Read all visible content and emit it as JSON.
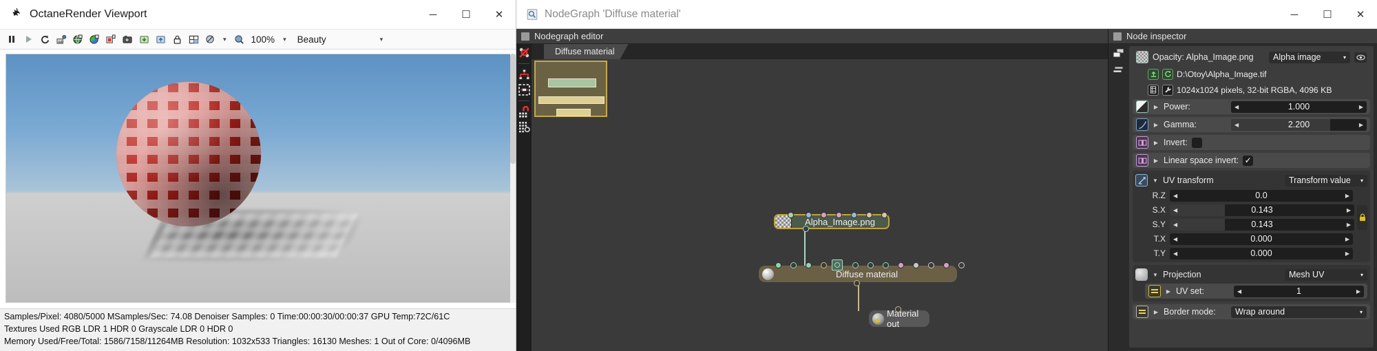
{
  "viewport": {
    "title": "OctaneRender Viewport",
    "logo_icon": "octane-logo-icon",
    "window_controls": {
      "minimize": "─",
      "maximize": "☐",
      "close": "✕"
    },
    "toolbar": {
      "items": [
        {
          "name": "pause-button",
          "glyph": "pause"
        },
        {
          "name": "play-button",
          "glyph": "play"
        },
        {
          "name": "restart-render-button",
          "glyph": "restart"
        },
        {
          "name": "render-settings-button",
          "glyph": "settings"
        },
        {
          "name": "save-image-button",
          "glyph": "save-image"
        },
        {
          "name": "color-picker-button",
          "glyph": "color"
        },
        {
          "name": "save-render-pass-button",
          "glyph": "save-pass"
        },
        {
          "name": "camera-button",
          "glyph": "camera"
        },
        {
          "name": "import-button",
          "glyph": "import"
        },
        {
          "name": "export-button",
          "glyph": "export"
        },
        {
          "name": "lock-resolution-button",
          "glyph": "lock"
        },
        {
          "name": "region-render-button",
          "glyph": "grid"
        },
        {
          "name": "focus-picker-button",
          "glyph": "focus"
        }
      ],
      "zoom_level": "100%",
      "render_pass": "Beauty"
    },
    "status": {
      "line1": "Samples/Pixel: 4080/5000  MSamples/Sec: 74.08  Denoiser Samples: 0  Time:00:00:30/00:00:37  GPU Temp:72C/61C",
      "line2": "Textures Used RGB LDR 1  HDR 0  Grayscale LDR 0  HDR 0",
      "line3": "Memory Used/Free/Total: 1586/7158/11264MB  Resolution: 1032x533  Triangles: 16130  Meshes: 1 Out of Core: 0/4096MB"
    }
  },
  "nodegraph": {
    "title": "NodeGraph 'Diffuse material'",
    "title_icon": "nodegraph-icon",
    "window_controls": {
      "minimize": "─",
      "maximize": "☐",
      "close": "✕"
    },
    "editor_header": "Nodegraph editor",
    "tab_label": "Diffuse material",
    "toolbar_icons": [
      {
        "name": "unlink-nodes-icon"
      },
      {
        "name": "arrange-nodes-icon"
      },
      {
        "name": "group-nodes-icon"
      },
      {
        "name": "snap-to-grid-icon"
      },
      {
        "name": "show-grid-icon"
      }
    ],
    "nodes": [
      {
        "name": "node-alpha-image",
        "label": "Alpha_Image.png",
        "icon": "checker-thumbnail-icon"
      },
      {
        "name": "node-diffuse-material",
        "label": "Diffuse material",
        "icon": "material-sphere-icon"
      },
      {
        "name": "node-material-out",
        "label": "Material out",
        "icon": "material-out-icon"
      }
    ]
  },
  "inspector": {
    "header": "Node inspector",
    "node_icon": "checker-thumbnail-icon",
    "opacity_label": "Opacity: Alpha_Image.png",
    "type_dropdown": "Alpha image",
    "eye_icon": "visibility-eye-icon",
    "file_path": "D:\\Otoy\\Alpha_Image.tif",
    "file_info": "1024x1024 pixels, 32-bit RGBA, 4096 KB",
    "reload_icon": "reload-icon",
    "load-icon": "load-image-icon",
    "info_icon": "image-info-icon",
    "wrench_icon": "wrench-icon",
    "params": [
      {
        "name": "power",
        "label": "Power:",
        "value": "1.000",
        "icon": "power-gradient-icon",
        "fill": 100
      },
      {
        "name": "gamma",
        "label": "Gamma:",
        "value": "2.200",
        "icon": "gamma-curve-icon",
        "fill": 73
      }
    ],
    "invert": {
      "label": "Invert:",
      "checked": false,
      "mark": "",
      "icon": "invert-icon"
    },
    "linear_space_invert": {
      "label": "Linear space invert:",
      "checked": true,
      "mark": "✓",
      "icon": "invert-icon"
    },
    "uv_transform": {
      "label": "UV transform",
      "icon": "uv-transform-icon",
      "mode": "Transform value",
      "fields": [
        {
          "key": "R.Z",
          "value": "0.0",
          "fill": 0
        },
        {
          "key": "S.X",
          "value": "0.143",
          "fill": 30
        },
        {
          "key": "S.Y",
          "value": "0.143",
          "fill": 30
        },
        {
          "key": "T.X",
          "value": "0.000",
          "fill": 0
        },
        {
          "key": "T.Y",
          "value": "0.000",
          "fill": 0
        }
      ],
      "lock_icon": "lock-icon"
    },
    "projection": {
      "label": "Projection",
      "value": "Mesh UV",
      "icon": "projection-icon",
      "uv_set": {
        "label": "UV set:",
        "value": "1",
        "icon": "uv-set-icon"
      }
    },
    "border_mode": {
      "label": "Border mode:",
      "value": "Wrap around",
      "icon": "border-mode-icon"
    }
  },
  "colors": {
    "accent_green": "#a9d8c4",
    "accent_yellow": "#c7bb8a",
    "node_gold_border": "#c0a33c",
    "panel_bg": "#3d3d3d"
  }
}
